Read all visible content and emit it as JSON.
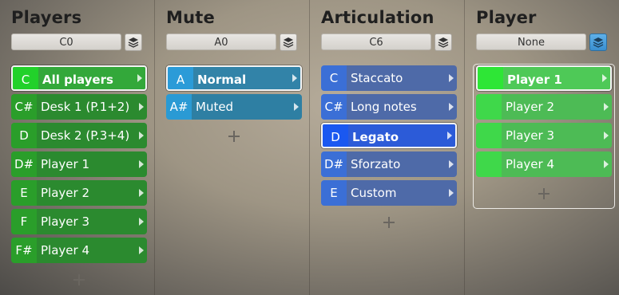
{
  "columns": [
    {
      "title": "Players",
      "select_value": "C0",
      "layer_active": false,
      "items": [
        {
          "key": "C",
          "label": "All players"
        },
        {
          "key": "C#",
          "label": "Desk 1 (P.1+2)"
        },
        {
          "key": "D",
          "label": "Desk 2 (P.3+4)"
        },
        {
          "key": "D#",
          "label": "Player 1"
        },
        {
          "key": "E",
          "label": "Player 2"
        },
        {
          "key": "F",
          "label": "Player 3"
        },
        {
          "key": "F#",
          "label": "Player 4"
        }
      ]
    },
    {
      "title": "Mute",
      "select_value": "A0",
      "layer_active": false,
      "items": [
        {
          "key": "A",
          "label": "Normal"
        },
        {
          "key": "A#",
          "label": "Muted"
        }
      ]
    },
    {
      "title": "Articulation",
      "select_value": "C6",
      "layer_active": false,
      "items": [
        {
          "key": "C",
          "label": "Staccato"
        },
        {
          "key": "C#",
          "label": "Long notes"
        },
        {
          "key": "D",
          "label": "Legato"
        },
        {
          "key": "D#",
          "label": "Sforzato"
        },
        {
          "key": "E",
          "label": "Custom"
        }
      ]
    },
    {
      "title": "Player",
      "select_value": "None",
      "layer_active": true,
      "items": [
        {
          "key": "",
          "label": "Player 1"
        },
        {
          "key": "",
          "label": "Player 2"
        },
        {
          "key": "",
          "label": "Player 3"
        },
        {
          "key": "",
          "label": "Player 4"
        }
      ]
    }
  ],
  "colors": {
    "players": "#2b8a2f",
    "mute": "#2e7fa3",
    "articulation": "#4e6aa8",
    "articulation_selected": "#1a58f0",
    "player": "#4dbb55"
  },
  "icons": {
    "layer": "layers-icon",
    "add": "plus-icon",
    "expand": "chevron-right-icon"
  }
}
